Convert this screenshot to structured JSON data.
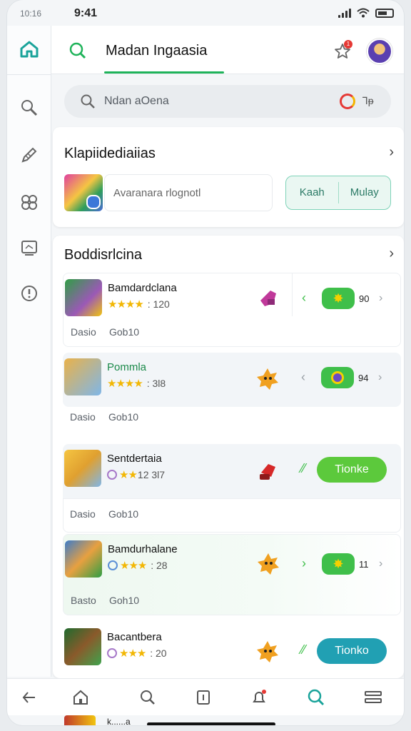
{
  "status": {
    "left_time": "10:16",
    "time": "9:41"
  },
  "header": {
    "title": "Madan Ingaasia",
    "notification_count": "1"
  },
  "search": {
    "placeholder": "Ndan aOena",
    "mic_label": "Ꞁᵽ"
  },
  "featured": {
    "title": "Klapiidediaiias",
    "text": "Avaranara rlognotl",
    "btn_left": "Kaah",
    "btn_right": "Mulay"
  },
  "list": {
    "title": "Boddisrlcina",
    "items": [
      {
        "name": "Bamdardclana",
        "rating_text": ": 120",
        "sub1": "Dasio",
        "sub2": "Gob10",
        "count": "90",
        "action": null
      },
      {
        "name": "Pommla",
        "rating_text": ": 3l8",
        "sub1": "Dasio",
        "sub2": "Gob10",
        "count": "94",
        "action": null
      },
      {
        "name": "Sentdertaia",
        "rating_text": "12 3l7",
        "sub1": "Dasio",
        "sub2": "Gob10",
        "count": null,
        "action": "Tionke"
      },
      {
        "name": "Bamdurhalane",
        "rating_text": ": 28",
        "sub1": "Basto",
        "sub2": "Goh10",
        "count": "11",
        "action": null
      },
      {
        "name": "Bacantbera",
        "rating_text": ": 20",
        "sub1": "",
        "sub2": "",
        "count": null,
        "action": "Tionko"
      }
    ]
  },
  "peek": {
    "text": "k......a"
  },
  "colors": {
    "accent": "#1fb35a",
    "chip_green": "#3fbf4a",
    "btn_green": "#5cc93c",
    "btn_teal": "#21a0b3"
  },
  "icons": [
    "home-icon",
    "search-icon",
    "pencil-icon",
    "grid-icon",
    "screen-icon",
    "info-icon",
    "star-icon",
    "back-icon",
    "bell-icon",
    "menu-icon"
  ]
}
